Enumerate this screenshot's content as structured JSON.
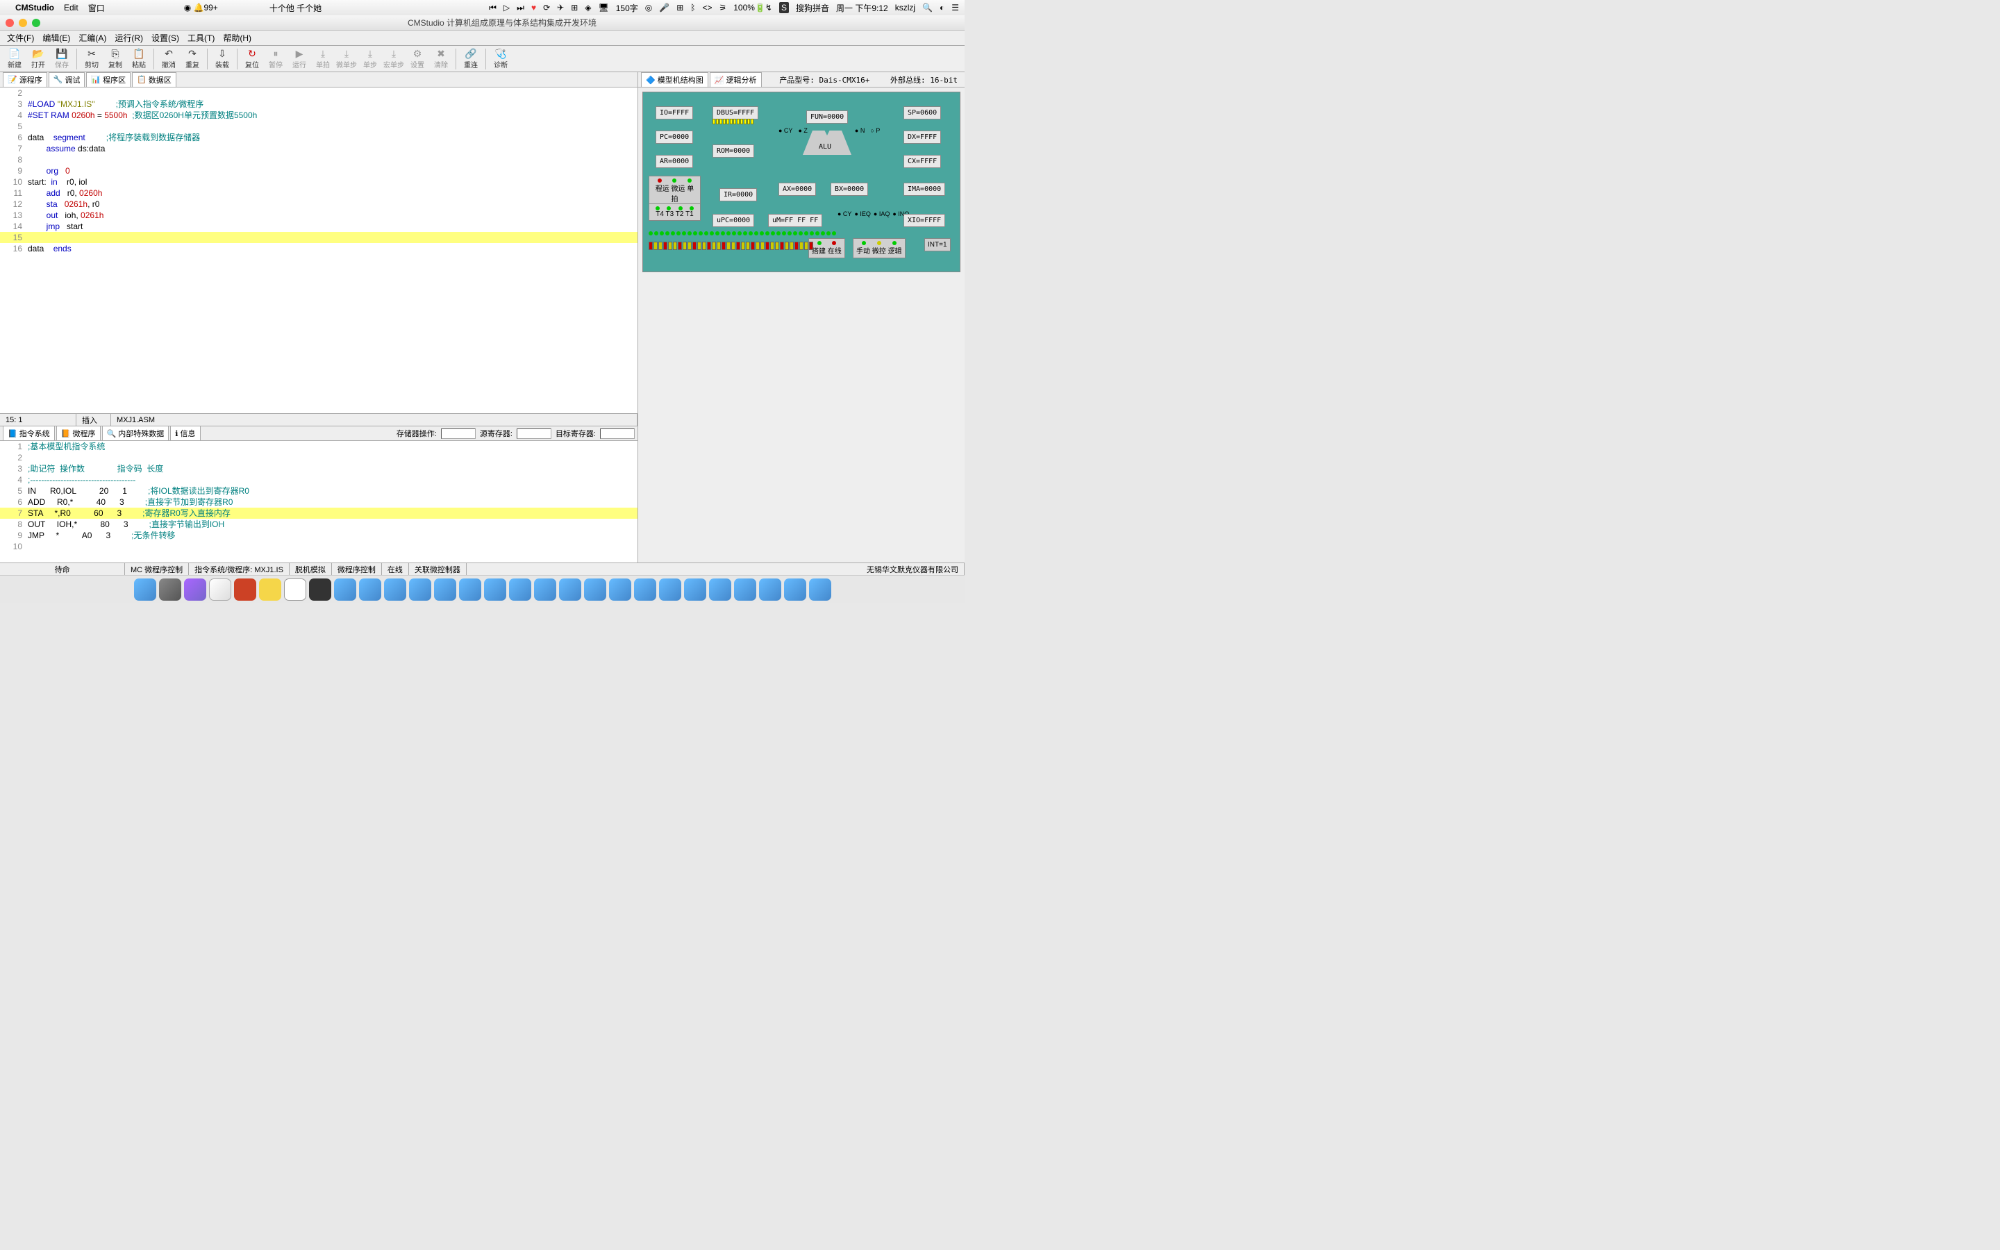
{
  "menubar": {
    "apple": "",
    "app": "CMStudio",
    "items": [
      "Edit",
      "窗口"
    ],
    "center": "十个他 千个她",
    "right_status": "150字",
    "battery": "100%",
    "ime": "搜狗拼音",
    "datetime": "周一 下午9:12",
    "user": "kszlzj",
    "notif": "99+"
  },
  "window": {
    "title": "CMStudio 计算机组成原理与体系结构集成开发环境"
  },
  "app_menu": [
    "文件(F)",
    "编辑(E)",
    "汇编(A)",
    "运行(R)",
    "设置(S)",
    "工具(T)",
    "帮助(H)"
  ],
  "toolbar": [
    {
      "label": "新建",
      "icon": "📄"
    },
    {
      "label": "打开",
      "icon": "📂"
    },
    {
      "label": "保存",
      "icon": "💾",
      "disabled": true
    },
    {
      "sep": true
    },
    {
      "label": "剪切",
      "icon": "✂"
    },
    {
      "label": "复制",
      "icon": "⎘"
    },
    {
      "label": "粘贴",
      "icon": "📋"
    },
    {
      "sep": true
    },
    {
      "label": "撤消",
      "icon": "↶"
    },
    {
      "label": "重复",
      "icon": "↷"
    },
    {
      "sep": true
    },
    {
      "label": "装载",
      "icon": "⇩"
    },
    {
      "sep": true
    },
    {
      "label": "复位",
      "icon": "↻",
      "red": true
    },
    {
      "label": "暂停",
      "icon": "⏸",
      "disabled": true
    },
    {
      "label": "运行",
      "icon": "▶",
      "disabled": true
    },
    {
      "label": "单拍",
      "icon": "⤓",
      "disabled": true
    },
    {
      "label": "微单步",
      "icon": "⤓",
      "disabled": true
    },
    {
      "label": "单步",
      "icon": "⤓",
      "disabled": true
    },
    {
      "label": "宏单步",
      "icon": "⤓",
      "disabled": true
    },
    {
      "label": "设置",
      "icon": "⚙",
      "disabled": true
    },
    {
      "label": "清除",
      "icon": "✖",
      "disabled": true
    },
    {
      "sep": true
    },
    {
      "label": "重连",
      "icon": "🔗"
    },
    {
      "sep": true
    },
    {
      "label": "诊断",
      "icon": "🩺"
    }
  ],
  "src_tabs": [
    "源程序",
    "调试",
    "程序区",
    "数据区"
  ],
  "source": {
    "lines": [
      {
        "n": 2,
        "t": ""
      },
      {
        "n": 3,
        "t": "#LOAD \"MXJ1.IS\"         ;预调入指令系统/微程序",
        "k": "load"
      },
      {
        "n": 4,
        "t": "#SET RAM 0260h = 5500h  ;数据区0260H单元预置数据5500h",
        "k": "set"
      },
      {
        "n": 5,
        "t": ""
      },
      {
        "n": 6,
        "t": "data    segment         ;将程序装载到数据存储器",
        "k": "seg"
      },
      {
        "n": 7,
        "t": "        assume ds:data"
      },
      {
        "n": 8,
        "t": ""
      },
      {
        "n": 9,
        "t": "        org   0",
        "k": "org"
      },
      {
        "n": 10,
        "t": "start:  in    r0, iol",
        "k": "in"
      },
      {
        "n": 11,
        "t": "        add   r0, 0260h",
        "k": "add"
      },
      {
        "n": 12,
        "t": "        sta   0261h, r0",
        "k": "sta"
      },
      {
        "n": 13,
        "t": "        out   ioh, 0261h",
        "k": "out"
      },
      {
        "n": 14,
        "t": "        jmp   start",
        "k": "jmp"
      },
      {
        "n": 15,
        "t": "",
        "hl": true
      },
      {
        "n": 16,
        "t": "data    ends"
      }
    ],
    "status_pos": "15:   1",
    "status_mode": "插入",
    "filename": "MXJ1.ASM"
  },
  "right_panel": {
    "tabs": [
      "模型机结构图",
      "逻辑分析"
    ],
    "product": "产品型号: Dais-CMX16+",
    "bus": "外部总线: 16-bit",
    "regs": {
      "IO": "IO=FFFF",
      "DBUS": "DBUS=FFFF",
      "FUN": "FUN=0000",
      "SP": "SP=0600",
      "PC": "PC=0000",
      "ROM": "ROM=0000",
      "DX": "DX=FFFF",
      "AR": "AR=0000",
      "CX": "CX=FFFF",
      "AX": "AX=0000",
      "BX": "BX=0000",
      "IMA": "IMA=0000",
      "IR": "IR=0000",
      "uPC": "uPC=0000",
      "uM": "uM=FF FF FF",
      "XIO": "XIO=FFFF",
      "ALU": "ALU",
      "flags_top": [
        "CY",
        "Z",
        "N",
        "P"
      ],
      "flags_bot": [
        "CY",
        "IEQ",
        "IAQ",
        "INQ"
      ],
      "INT": "INT=1"
    },
    "ctrl_btns1": [
      "程运",
      "微运",
      "单拍"
    ],
    "ctrl_ts": [
      "T4",
      "T3",
      "T2",
      "T1"
    ],
    "ctrl_btns2": [
      "搭建",
      "在线"
    ],
    "ctrl_btns3": [
      "手动",
      "微控",
      "逻辑"
    ]
  },
  "bottom_tabs": [
    "指令系统",
    "微程序",
    "内部特殊数据",
    "信息"
  ],
  "bottom_fields": {
    "mem_op": "存储器操作:",
    "src_reg": "源寄存器:",
    "dst_reg": "目标寄存器:"
  },
  "isa": {
    "header": ";基本模型机指令系统",
    "cols": ";助记符  操作数              指令码  长度",
    "dash": ";--------------------------------------",
    "rows": [
      {
        "n": 5,
        "m": "IN",
        "op": "R0,IOL",
        "code": "20",
        "len": "1",
        "c": ";将IOL数据读出到寄存器R0"
      },
      {
        "n": 6,
        "m": "ADD",
        "op": "R0,*",
        "code": "40",
        "len": "3",
        "c": ";直接字节加到寄存器R0"
      },
      {
        "n": 7,
        "m": "STA",
        "op": "*,R0",
        "code": "60",
        "len": "3",
        "c": ";寄存器R0写入直接内存",
        "hl": true
      },
      {
        "n": 8,
        "m": "OUT",
        "op": "IOH,*",
        "code": "80",
        "len": "3",
        "c": ";直接字节输出到IOH"
      },
      {
        "n": 9,
        "m": "JMP",
        "op": "*",
        "code": "A0",
        "len": "3",
        "c": ";无条件转移"
      }
    ]
  },
  "footer": {
    "idle": "待命",
    "cells": [
      "MC 微程序控制",
      "指令系统/微程序: MXJ1.IS",
      "脱机模拟",
      "微程序控制",
      "在线",
      "关联微控制器"
    ],
    "company": "无锡华文默克仪器有限公司"
  }
}
